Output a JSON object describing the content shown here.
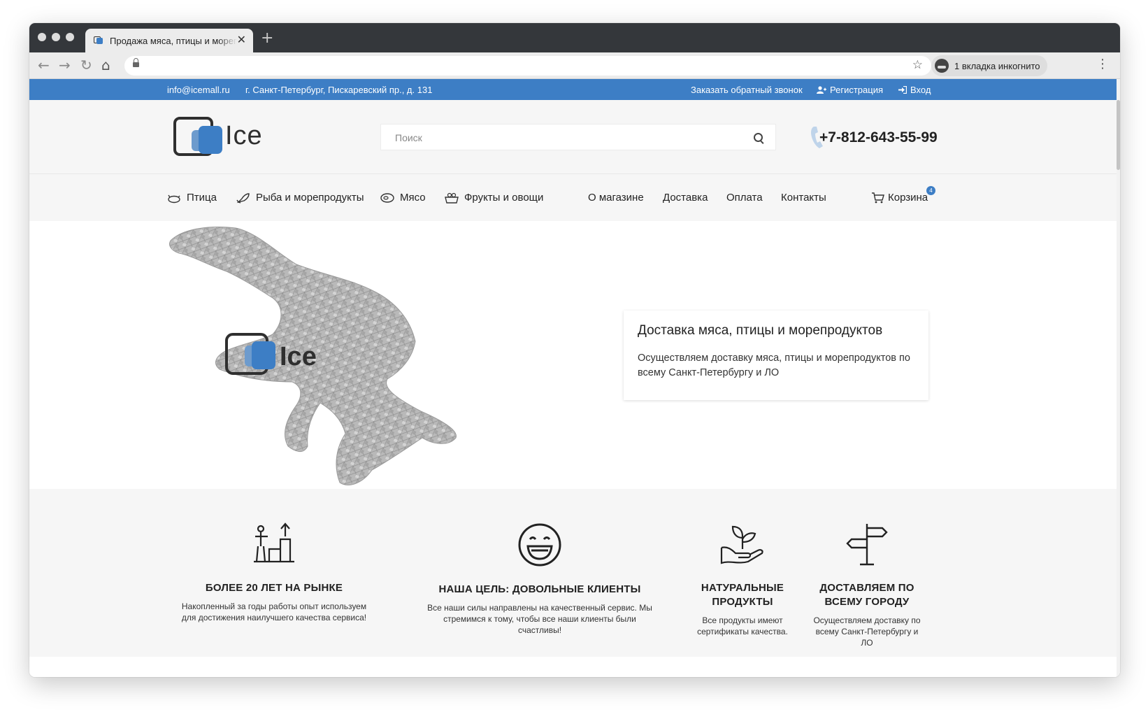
{
  "browser": {
    "tab_title": "Продажа мяса, птицы и морепродуктов",
    "tab_close": "✕",
    "new_tab": "+",
    "incognito_label": "1 вкладка инкогнито"
  },
  "topbar": {
    "email": "info@icemall.ru",
    "address": "г. Санкт-Петербург, Пискаревский пр., д. 131",
    "callback": "Заказать обратный звонок",
    "register": "Регистрация",
    "login": "Вход"
  },
  "header": {
    "logo_text": "Ice",
    "search_placeholder": "Поиск",
    "phone": "+7-812-643-55-99"
  },
  "nav": {
    "poultry": "Птица",
    "fish": "Рыба и морепродукты",
    "meat": "Мясо",
    "fruits": "Фрукты и овощи",
    "about": "О магазине",
    "delivery": "Доставка",
    "payment": "Оплата",
    "contacts": "Контакты",
    "cart": "Корзина",
    "cart_count": "4"
  },
  "hero": {
    "map_logo_text": "Ice",
    "card_title": "Доставка мяса, птицы и морепродуктов",
    "card_text": "Осуществляем доставку мяса, птицы и морепродуктов по всему Санкт-Петербургу и ЛО"
  },
  "features": [
    {
      "icon": "growth-stairs-icon",
      "title": "БОЛЕЕ 20 ЛЕТ НА РЫНКЕ",
      "text": "Накопленный за годы работы опыт используем для достижения наилучшего качества сервиса!"
    },
    {
      "icon": "smiley-icon",
      "title": "НАША ЦЕЛЬ: ДОВОЛЬНЫЕ КЛИЕНТЫ",
      "text": "Все наши силы направлены на качественный сервис. Мы стремимся к тому, чтобы все наши клиенты были счастливы!"
    },
    {
      "icon": "plant-hand-icon",
      "title": "НАТУРАЛЬНЫЕ ПРОДУКТЫ",
      "text": "Все продукты имеют сертификаты качества."
    },
    {
      "icon": "signpost-icon",
      "title": "ДОСТАВЛЯЕМ ПО ВСЕМУ ГОРОДУ",
      "text": "Осуществляем доставку по всему Санкт-Петербургу и ЛО"
    }
  ],
  "colors": {
    "accent": "#3d7ec5",
    "header_bg": "#f6f6f6",
    "text": "#222222"
  }
}
